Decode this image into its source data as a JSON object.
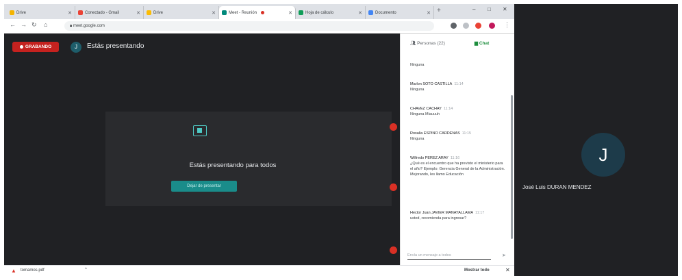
{
  "browser": {
    "tabs": [
      {
        "label": "Drive",
        "color": "#f4b400"
      },
      {
        "label": "Conectado - Gmail",
        "color": "#ea4335"
      },
      {
        "label": "Drive",
        "color": "#fbbc04"
      },
      {
        "label": "Meet - Reunión",
        "color": "#00897b"
      },
      {
        "label": "Hoja de cálculo",
        "color": "#0f9d58"
      },
      {
        "label": "Documento",
        "color": "#4285f4"
      }
    ],
    "new_tab": "+",
    "url": "meet.google.com",
    "window_controls": [
      "–",
      "□",
      "✕"
    ]
  },
  "meet": {
    "recording_label": "GRABANDO",
    "presenter_initial": "J",
    "presenting_label": "Estás presentando",
    "stage_text": "Estás presentando para todos",
    "stop_button": "Dejar de presentar"
  },
  "panel": {
    "people_tab": "Personas (22)",
    "chat_tab": "Chat",
    "messages": [
      {
        "sender": "",
        "time": "",
        "text": "Ninguna"
      },
      {
        "sender": "Marlon SOTO CASTILLA",
        "time": "11:14",
        "text": "Ninguna"
      },
      {
        "sender": "CHAVEZ CACHAY",
        "time": "11:14",
        "text": "Ninguna Miauuuh"
      },
      {
        "sender": "Rosalia ESPINO CARDENAS",
        "time": "11:15",
        "text": "Ninguna"
      },
      {
        "sender": "Wilfredo PEREZ ARAY",
        "time": "11:16",
        "text": "¿Qué es el encuentro que ha previsto el ministerio para el año? Ejemplo: Gerencia General de la Administración. Mejorando, les llamo Educación"
      },
      {
        "sender": "Hector Juan JAVIER MANAYALLAMA",
        "time": "11:17",
        "text": "usted, recomienda para ingresar?"
      }
    ],
    "chat_placeholder": "Envía un mensaje a todos",
    "send_icon": "send-icon"
  },
  "download_bar": {
    "file_name": "tomamos.pdf",
    "show_all": "Mostrar todo",
    "close": "✕"
  },
  "participant": {
    "initial": "J",
    "name": "José Luis DURAN MENDEZ"
  },
  "colors": {
    "meet_bg": "#202124",
    "recording": "#c5221f",
    "accent_teal": "#1a8c8a",
    "chat_green": "#1e8e3e"
  }
}
